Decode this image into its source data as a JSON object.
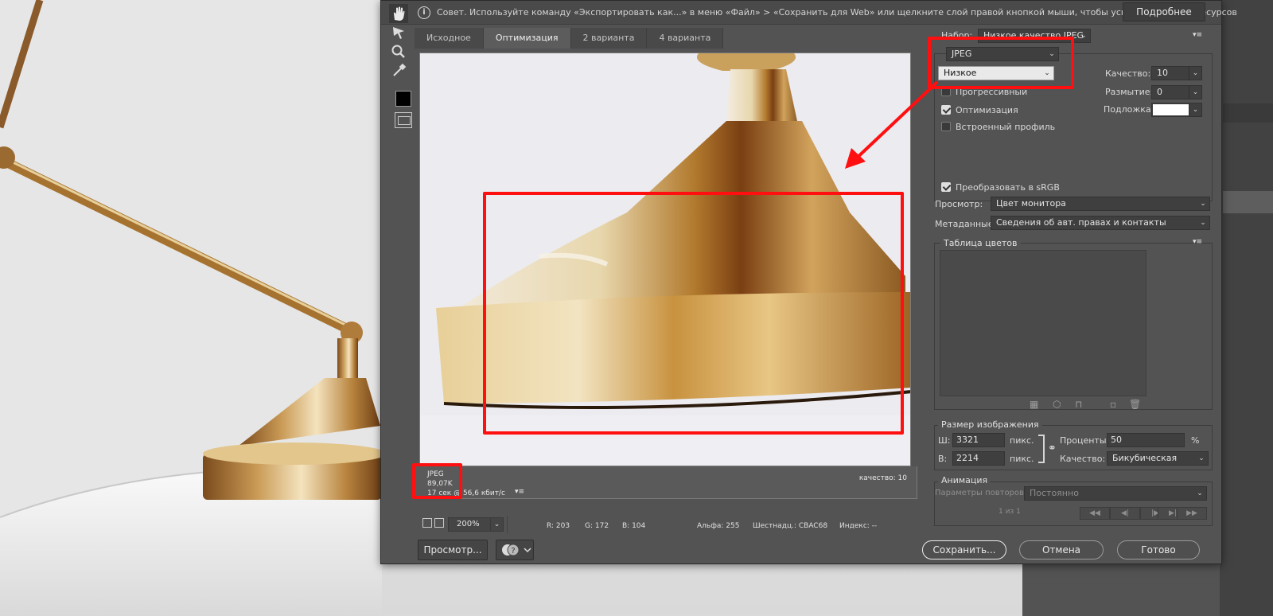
{
  "tip_bar": {
    "text": "Совет. Используйте команду «Экспортировать как...» в меню «Файл» > «Сохранить для Web» или щелкните слой правой кнопкой мыши, чтобы ускорить экспорт ресурсов",
    "more_button": "Подробнее"
  },
  "tabs": [
    "Исходное",
    "Оптимизация",
    "2 варианта",
    "4 варианта"
  ],
  "active_tab": "Оптимизация",
  "preview_info": {
    "format": "JPEG",
    "size": "89,07K",
    "time": "17 сек @ 56,6 кбит/с",
    "quality": "качество: 10",
    "menu_icon": "▾≡"
  },
  "status": {
    "zoom": "200%",
    "r": "R: 203",
    "g": "G: 172",
    "b": "B: 104",
    "alpha": "Альфа: 255",
    "hex": "Шестнадц.: CBAC68",
    "index": "Индекс: --"
  },
  "buttons": {
    "preview": "Просмотр...",
    "save": "Сохранить...",
    "cancel": "Отмена",
    "done": "Готово"
  },
  "settings": {
    "preset_label": "Набор:",
    "preset_value": "Низкое качество JPEG",
    "format_value": "JPEG",
    "compression_value": "Низкое",
    "progressive_label": "Прогрессивный",
    "progressive_checked": false,
    "optimized_label": "Оптимизация",
    "optimized_checked": true,
    "embed_profile_label": "Встроенный профиль",
    "embed_profile_checked": false,
    "quality_label": "Качество:",
    "quality_value": "10",
    "blur_label": "Размытие:",
    "blur_value": "0",
    "matte_label": "Подложка:",
    "convert_srgb_label": "Преобразовать в sRGB",
    "convert_srgb_checked": true,
    "preview_label": "Просмотр:",
    "preview_value": "Цвет монитора",
    "metadata_label": "Метаданные:",
    "metadata_value": "Сведения об авт. правах и контакты",
    "color_table_title": "Таблица цветов"
  },
  "image_size": {
    "title": "Размер изображения",
    "width_label": "Ш:",
    "width_value": "3321",
    "height_label": "В:",
    "height_value": "2214",
    "unit": "пикс.",
    "percent_label": "Проценты:",
    "percent_value": "50",
    "percent_unit": "%",
    "quality_label": "Качество:",
    "quality_value": "Бикубическая"
  },
  "animation": {
    "title": "Анимация",
    "loop_label": "Параметры повторов:",
    "loop_value": "Постоянно",
    "frame_counter": "1 из 1"
  },
  "colors": {
    "annotation_red": "#ff0f0f",
    "dialog_bg": "#535353"
  }
}
